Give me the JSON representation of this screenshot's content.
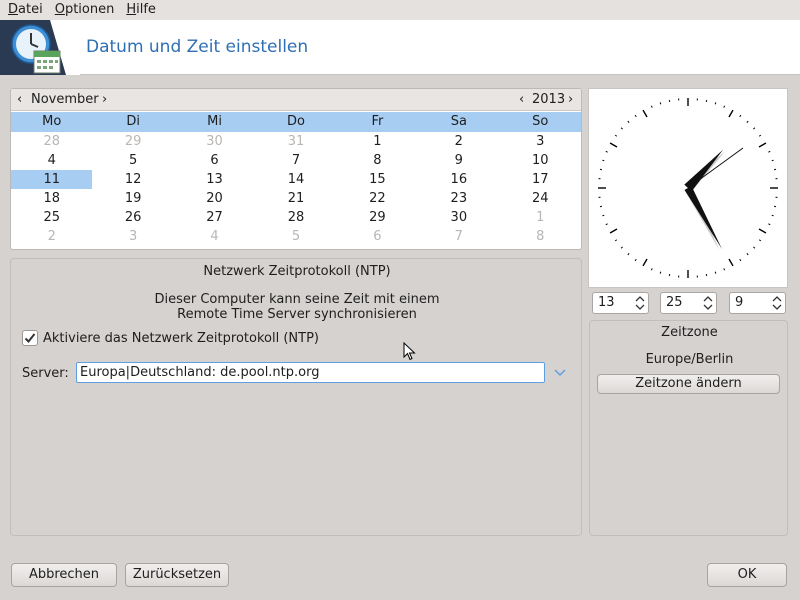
{
  "menu": {
    "items": [
      {
        "first": "D",
        "rest": "atei"
      },
      {
        "first": "O",
        "rest": "ptionen"
      },
      {
        "first": "H",
        "rest": "ilfe"
      }
    ]
  },
  "header": {
    "title": "Datum und Zeit einstellen",
    "icon": "clock-calendar-icon"
  },
  "calendar": {
    "month": "November",
    "year": "2013",
    "weekdays": [
      "Mo",
      "Di",
      "Mi",
      "Do",
      "Fr",
      "Sa",
      "So"
    ],
    "weeks": [
      [
        "28",
        "29",
        "30",
        "31",
        "1",
        "2",
        "3"
      ],
      [
        "4",
        "5",
        "6",
        "7",
        "8",
        "9",
        "10"
      ],
      [
        "11",
        "12",
        "13",
        "14",
        "15",
        "16",
        "17"
      ],
      [
        "18",
        "19",
        "20",
        "21",
        "22",
        "23",
        "24"
      ],
      [
        "25",
        "26",
        "27",
        "28",
        "29",
        "30",
        "1"
      ],
      [
        "2",
        "3",
        "4",
        "5",
        "6",
        "7",
        "8"
      ]
    ],
    "other_month": [
      [
        true,
        true,
        true,
        true,
        false,
        false,
        false
      ],
      [
        false,
        false,
        false,
        false,
        false,
        false,
        false
      ],
      [
        false,
        false,
        false,
        false,
        false,
        false,
        false
      ],
      [
        false,
        false,
        false,
        false,
        false,
        false,
        false
      ],
      [
        false,
        false,
        false,
        false,
        false,
        false,
        true
      ],
      [
        true,
        true,
        true,
        true,
        true,
        true,
        true
      ]
    ],
    "selected": "11"
  },
  "clock": {
    "hours": 13,
    "minutes": 25,
    "seconds": 9
  },
  "time": {
    "hour": "13",
    "minute": "25",
    "second": "9"
  },
  "ntp": {
    "title": "Netzwerk Zeitprotokoll (NTP)",
    "description_line1": "Dieser Computer kann seine Zeit mit einem",
    "description_line2": "Remote Time Server synchronisieren",
    "checkbox_label": "Aktiviere das Netzwerk Zeitprotokoll (NTP)",
    "checkbox_checked": true,
    "server_label": "Server:",
    "server_value": "Europa|Deutschland: de.pool.ntp.org"
  },
  "timezone": {
    "title": "Zeitzone",
    "value": "Europe/Berlin",
    "change_button": "Zeitzone ändern"
  },
  "buttons": {
    "cancel": "Abbrechen",
    "reset": "Zurücksetzen",
    "ok": "OK"
  },
  "colors": {
    "title_blue": "#2f6fb4",
    "selection": "#a8cdf2",
    "banner_icon_bg": "#2a3a52"
  }
}
